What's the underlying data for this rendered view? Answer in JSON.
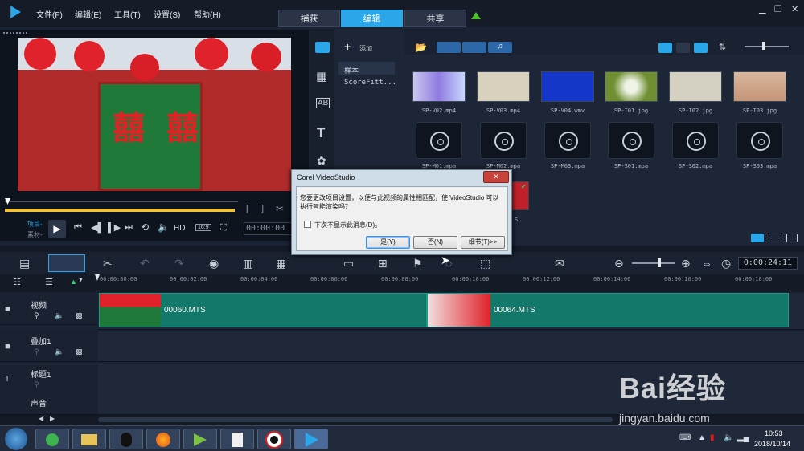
{
  "menu": {
    "file": "文件(F)",
    "edit": "编辑(E)",
    "tools": "工具(T)",
    "settings": "设置(S)",
    "help": "帮助(H)"
  },
  "steps": {
    "capture": "捕获",
    "edit": "编辑",
    "share": "共享"
  },
  "preview": {
    "project_label": "项目-",
    "clip_label": "素材-",
    "hd": "HD",
    "aspect": "16:9",
    "timecode": "00:00:00"
  },
  "library": {
    "add_label": "添加",
    "folders": [
      "样本",
      "ScoreFitt..."
    ],
    "media_row1": [
      "SP-V02.mp4",
      "SP-V03.mp4",
      "SP-V04.wmv",
      "SP-I01.jpg",
      "SP-I02.jpg",
      "SP-I03.jpg"
    ],
    "media_row2": [
      "SP-M01.mpa",
      "SP-M02.mpa",
      "SP-M03.mpa",
      "SP-S01.mpa",
      "SP-S02.mpa",
      "SP-S03.mpa"
    ],
    "partial_label": "S"
  },
  "dialog": {
    "title": "Corel VideoStudio",
    "message": "您要更改项目设置，以便与此视频的属性相匹配，使 VideoStudio 可以执行智能渲染吗？",
    "checkbox": "下次不显示此消息(D)。",
    "yes": "是(Y)",
    "no": "否(N)",
    "details": "细节(T)>>"
  },
  "timeline": {
    "duration": "0:00:24:11",
    "ticks": [
      "00:00:00:00",
      "00:00:02:00",
      "00:00:04:00",
      "00:00:06:00",
      "00:00:08:00",
      "00:00:10:00",
      "00:00:12:00",
      "00:00:14:00",
      "00:00:16:00",
      "00:00:18:00"
    ],
    "tracks": [
      "视频",
      "叠加1",
      "标题1",
      "声音"
    ],
    "clips": [
      "00060.MTS",
      "00064.MTS"
    ]
  },
  "clock": {
    "time": "10:53",
    "date": "2018/10/14"
  },
  "watermark": {
    "brand": "Bai经验",
    "url": "jingyan.baidu.com"
  },
  "colors": {
    "accent": "#2aa7e8",
    "clip": "#11786a",
    "dialog": "#f0f0f0"
  }
}
